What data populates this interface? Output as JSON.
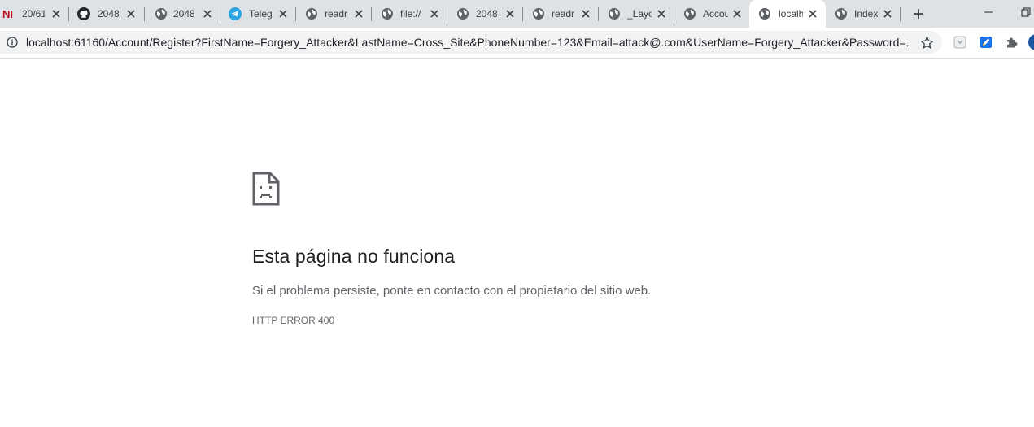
{
  "tabs": [
    {
      "title": "20/61",
      "icon": "ni-logo-icon"
    },
    {
      "title": "2048",
      "icon": "github-icon"
    },
    {
      "title": "2048",
      "icon": "globe-icon"
    },
    {
      "title": "Teleg",
      "icon": "telegram-icon"
    },
    {
      "title": "readr",
      "icon": "globe-icon"
    },
    {
      "title": "file://",
      "icon": "file-icon"
    },
    {
      "title": "2048",
      "icon": "globe-icon"
    },
    {
      "title": "readr",
      "icon": "globe-icon"
    },
    {
      "title": "_Layo",
      "icon": "globe-icon"
    },
    {
      "title": "Accou",
      "icon": "globe-icon"
    },
    {
      "title": "localh",
      "icon": "globe-icon",
      "active": true
    },
    {
      "title": "Index",
      "icon": "globe-icon"
    }
  ],
  "ni_logo_text": "NI",
  "address_bar": {
    "url": "localhost:61160/Account/Register?FirstName=Forgery_Attacker&LastName=Cross_Site&PhoneNumber=123&Email=attack@.com&UserName=Forgery_Attacker&Password=..."
  },
  "error_page": {
    "title": "Esta página no funciona",
    "message": "Si el problema persiste, ponte en contacto con el propietario del sitio web.",
    "code": "HTTP ERROR 400"
  },
  "colors": {
    "tabstrip_bg": "#dee1e6",
    "active_tab_bg": "#ffffff",
    "omnibox_bg": "#f1f3f4",
    "telegram_blue": "#2aa3df",
    "ni_red": "#b8131e",
    "text_primary": "#202124",
    "text_secondary": "#5f6368"
  }
}
